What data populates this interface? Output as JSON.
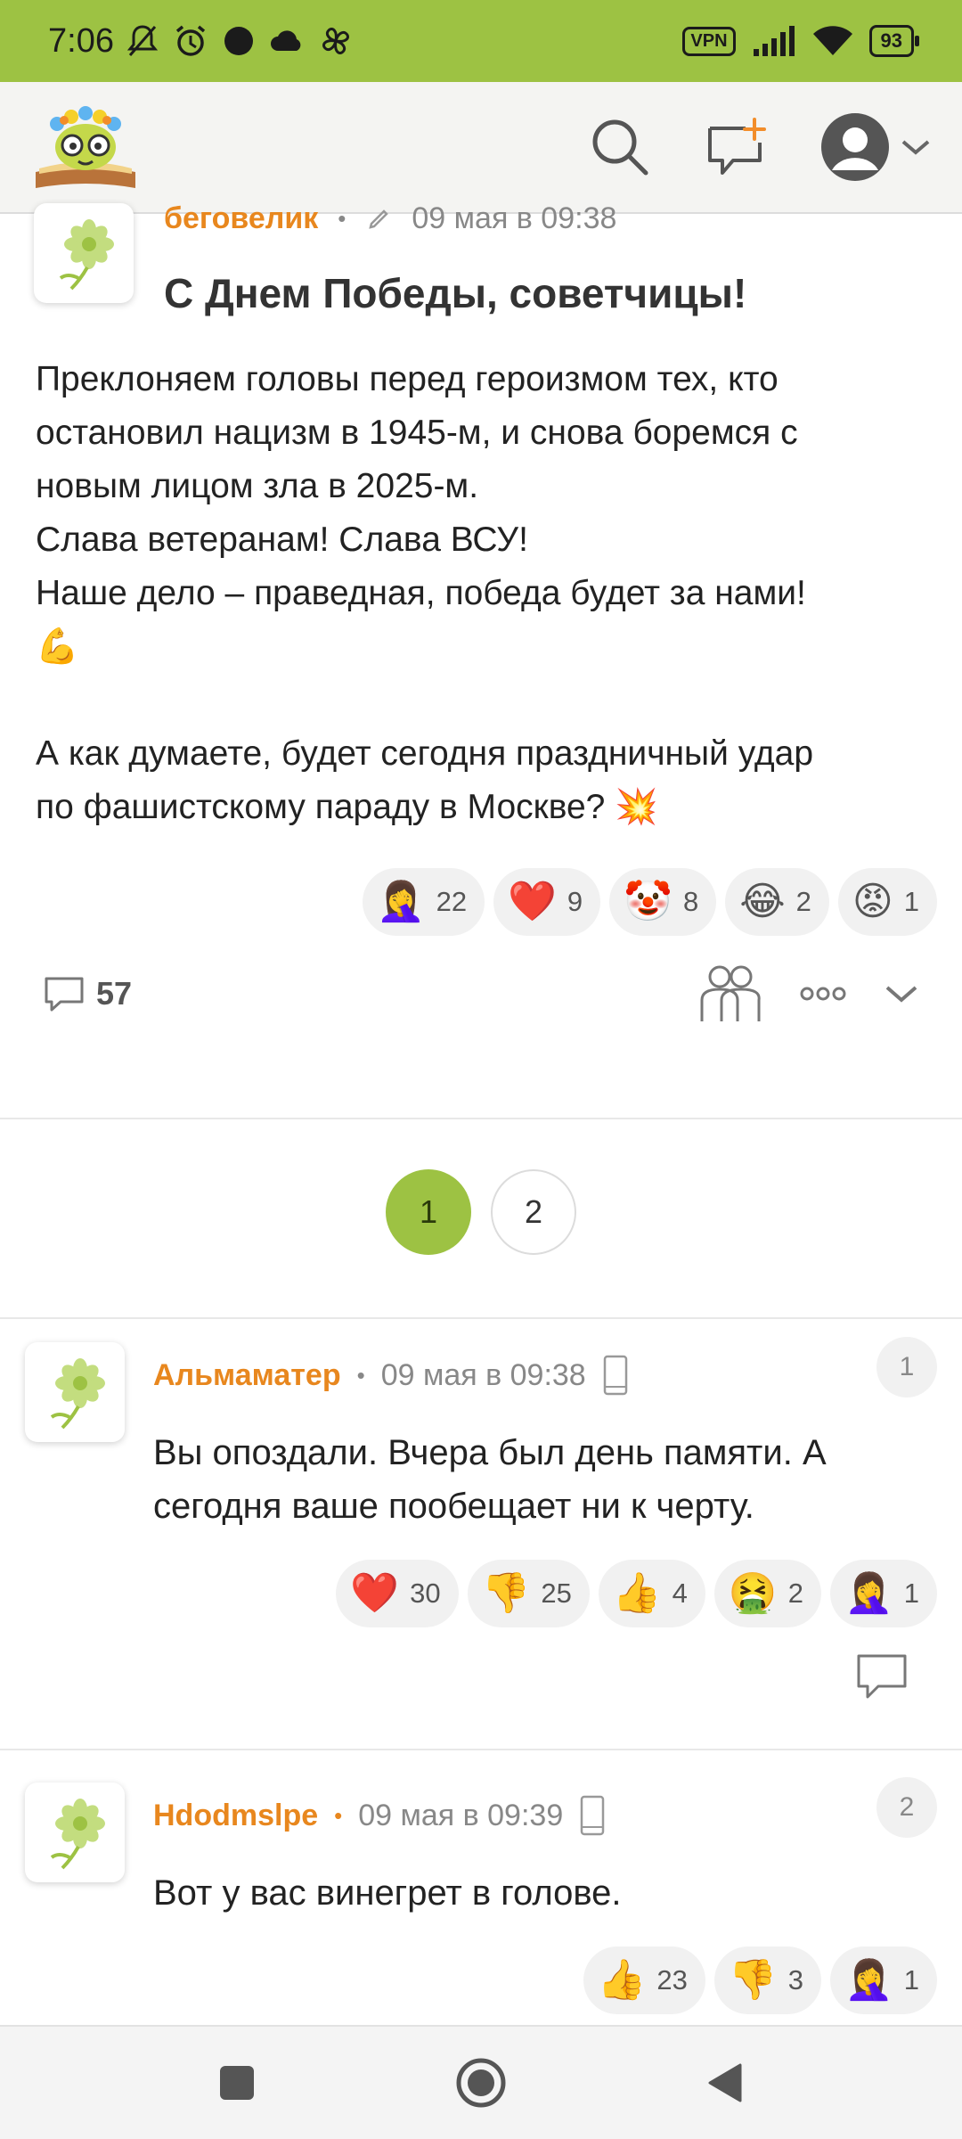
{
  "status_bar": {
    "time": "7:06",
    "vpn": "VPN",
    "battery": "93",
    "icons_left": [
      "bell-off-icon",
      "alarm-icon",
      "dot-icon",
      "cloud-icon",
      "fan-icon"
    ],
    "icons_right": [
      "vpn-icon",
      "signal-icon",
      "wifi-icon",
      "battery-icon"
    ],
    "bar_color": "#9dc243"
  },
  "header": {
    "logo": "flower-bookworm-logo",
    "icons": [
      "search-icon",
      "new-post-icon",
      "avatar-icon",
      "chevron-down-icon"
    ]
  },
  "post": {
    "author": "беговелик",
    "time": "09 мая в 09:38",
    "title": "С Днем Победы, советчицы!",
    "body_lines": [
      "Преклоняем головы перед героизмом тех, кто",
      "остановил нацизм в 1945-м, и снова боремся с",
      "новым лицом зла в 2025-м.",
      "Слава ветеранам! Слава ВСУ!",
      "Наше дело – праведная, победа будет за нами!",
      "💪",
      "",
      "А как думаете, будет сегодня праздничный удар",
      "по фашистскому параду в Москве? 💥"
    ],
    "reactions": [
      {
        "emoji": "🤦‍♀️",
        "count": "22"
      },
      {
        "emoji": "❤️",
        "count": "9"
      },
      {
        "emoji": "🤡",
        "count": "8"
      },
      {
        "emoji": "😂",
        "count": "2"
      },
      {
        "emoji": "😡",
        "count": "1"
      }
    ],
    "comments_count": "57"
  },
  "pagination": {
    "pages": [
      "1",
      "2"
    ],
    "active": "1"
  },
  "comments": [
    {
      "number": "1",
      "author": "Альмаматер",
      "time": "09 мая в 09:38",
      "text": "Вы опоздали. Вчера был день памяти. А сегодня ваше пообещает ни к черту.",
      "reactions": [
        {
          "emoji": "❤️",
          "count": "30"
        },
        {
          "emoji": "👎",
          "count": "25"
        },
        {
          "emoji": "👍",
          "count": "4"
        },
        {
          "emoji": "🤮",
          "count": "2"
        },
        {
          "emoji": "🤦‍♀️",
          "count": "1"
        }
      ]
    },
    {
      "number": "2",
      "author": "Hdodmslpe",
      "time": "09 мая в 09:39",
      "text": "Вот у вас винегрет в голове.",
      "reactions": [
        {
          "emoji": "👍",
          "count": "23"
        },
        {
          "emoji": "👎",
          "count": "3"
        },
        {
          "emoji": "🤦‍♀️",
          "count": "1"
        }
      ]
    }
  ],
  "colors": {
    "accent_green": "#9dc243",
    "author_orange": "#e8871e"
  }
}
